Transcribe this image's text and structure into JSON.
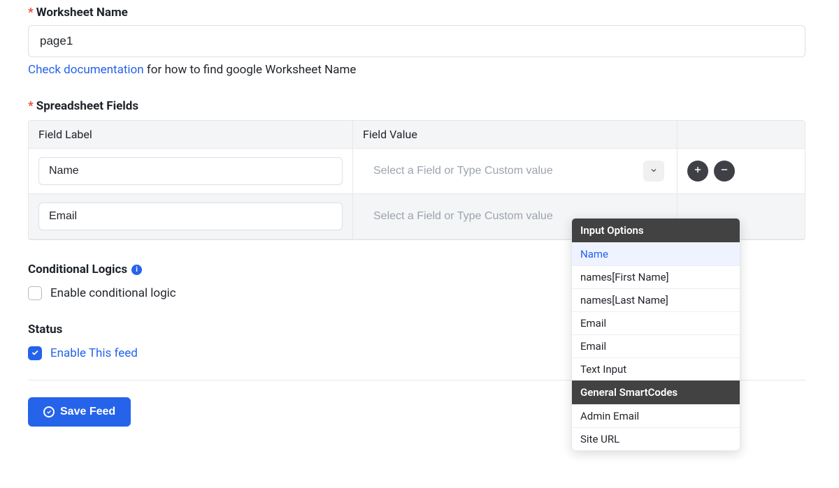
{
  "worksheet_label": "Worksheet Name",
  "worksheet_value": "page1",
  "doc_link_text": "Check documentation",
  "doc_helper_text": " for how to find google Worksheet Name",
  "spreadsheet_fields_label": "Spreadsheet Fields",
  "table_headers": {
    "label": "Field Label",
    "value": "Field Value"
  },
  "field_value_placeholder": "Select a Field or Type Custom value",
  "rows": [
    {
      "label": "Name"
    },
    {
      "label": "Email"
    }
  ],
  "dropdown": {
    "group1_title": "Input Options",
    "items1": [
      "Name",
      "names[First Name]",
      "names[Last Name]",
      "Email",
      "Email",
      "Text Input"
    ],
    "group2_title": "General SmartCodes",
    "items2": [
      "Admin Email",
      "Site URL"
    ]
  },
  "conditional": {
    "title": "Conditional Logics",
    "label": "Enable conditional logic"
  },
  "status": {
    "title": "Status",
    "label": "Enable This feed"
  },
  "save_button": "Save Feed"
}
